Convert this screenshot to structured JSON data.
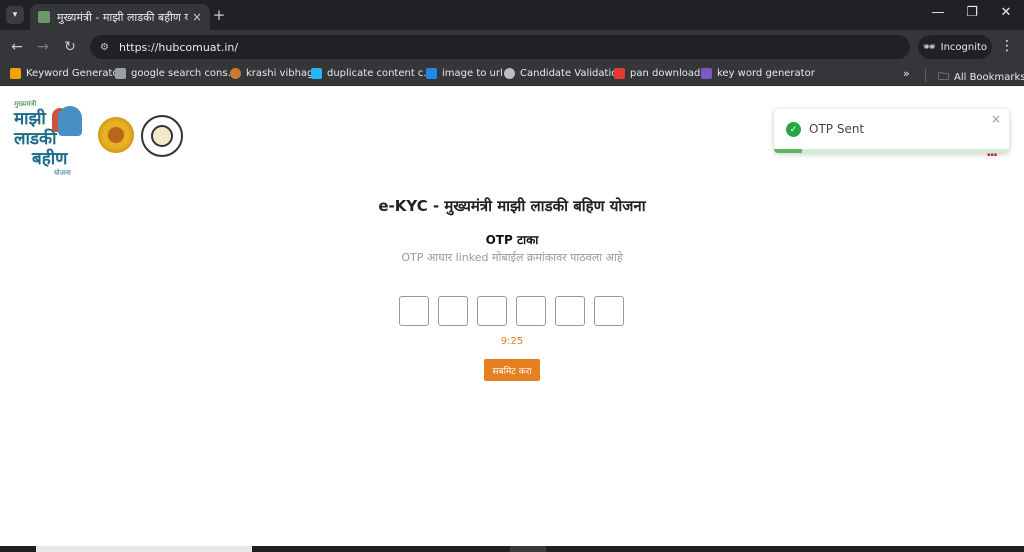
{
  "browser": {
    "tab": {
      "title": "मुख्यमंत्री - माझी लाडकी बहीण योजना",
      "close": "×"
    },
    "new_tab": "+",
    "window_controls": {
      "minimize": "—",
      "restore": "❐",
      "close": "✕"
    },
    "nav": {
      "back": "←",
      "forward": "→",
      "reload": "↻"
    },
    "url": "https://hubcomuat.in/",
    "incognito_label": "Incognito",
    "menu": "⋮",
    "bookmarks": [
      {
        "label": "Keyword Generator",
        "color": "#f4a300"
      },
      {
        "label": "google search cons...",
        "color": "#9aa0a6"
      },
      {
        "label": "krashi vibhag",
        "color": "#c97b32"
      },
      {
        "label": "duplicate content c...",
        "color": "#29b6f6"
      },
      {
        "label": "image to url",
        "color": "#1e88e5"
      },
      {
        "label": "Candidate Validation",
        "color": "#bdbdbd"
      },
      {
        "label": "pan download",
        "color": "#e53935"
      },
      {
        "label": "key word generator",
        "color": "#7e57c2"
      }
    ],
    "bookmarks_overflow": "»",
    "all_bookmarks": "All Bookmarks"
  },
  "header": {
    "logo_top_text": "मुख्यमंत्री",
    "logo_lines": [
      "माझी",
      "लाडकी",
      "बहीण"
    ],
    "logo_bottom_text": "योजना"
  },
  "toast": {
    "message": "OTP Sent",
    "close": "×",
    "progress": 0.12,
    "status_color": "#28a745"
  },
  "main": {
    "title": "e-KYC - मुख्यमंत्री माझी लाडकी बहिण योजना",
    "otp_heading": "OTP टाका",
    "otp_subtitle": "OTP आधार linked मोबाईल क्रमांकावर पाठवला आहे",
    "otp_digits": [
      "",
      "",
      "",
      "",
      "",
      ""
    ],
    "timer": "9:25",
    "submit_label": "सबमिट करा",
    "accent_color": "#e67e22"
  }
}
